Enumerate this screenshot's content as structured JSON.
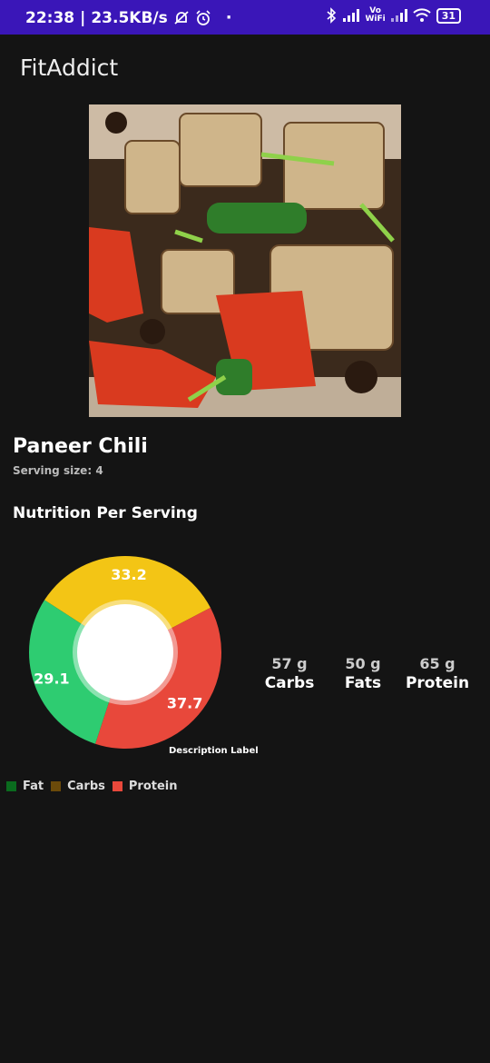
{
  "status_bar": {
    "time": "22:38",
    "separator": "|",
    "net_speed": "23.5KB/s",
    "vo": "Vo",
    "wifi_label": "WiFi",
    "battery": "31"
  },
  "app": {
    "title": "FitAddict"
  },
  "recipe": {
    "name": "Paneer Chili",
    "serving_label": "Serving size:",
    "serving_value": "4"
  },
  "nutrition": {
    "section_title": "Nutrition Per Serving",
    "chart_label": "Description Label",
    "macros": [
      {
        "amount": "57 g",
        "label": "Carbs"
      },
      {
        "amount": "50 g",
        "label": "Fats"
      },
      {
        "amount": "65 g",
        "label": "Protein"
      }
    ],
    "legend": [
      {
        "label": "Fat",
        "color": "#0a6b1e"
      },
      {
        "label": "Carbs",
        "color": "#6b4a0a"
      },
      {
        "label": "Protein",
        "color": "#e8483b"
      }
    ]
  },
  "chart_data": {
    "type": "pie",
    "categories": [
      "Carbs",
      "Protein",
      "Fat"
    ],
    "values": [
      33.2,
      37.7,
      29.1
    ],
    "labels": [
      "33.2",
      "37.7",
      "29.1"
    ],
    "colors": [
      "#f3c515",
      "#e8483b",
      "#2ecc71"
    ],
    "start_angle_deg": -57.1,
    "hole": true
  }
}
